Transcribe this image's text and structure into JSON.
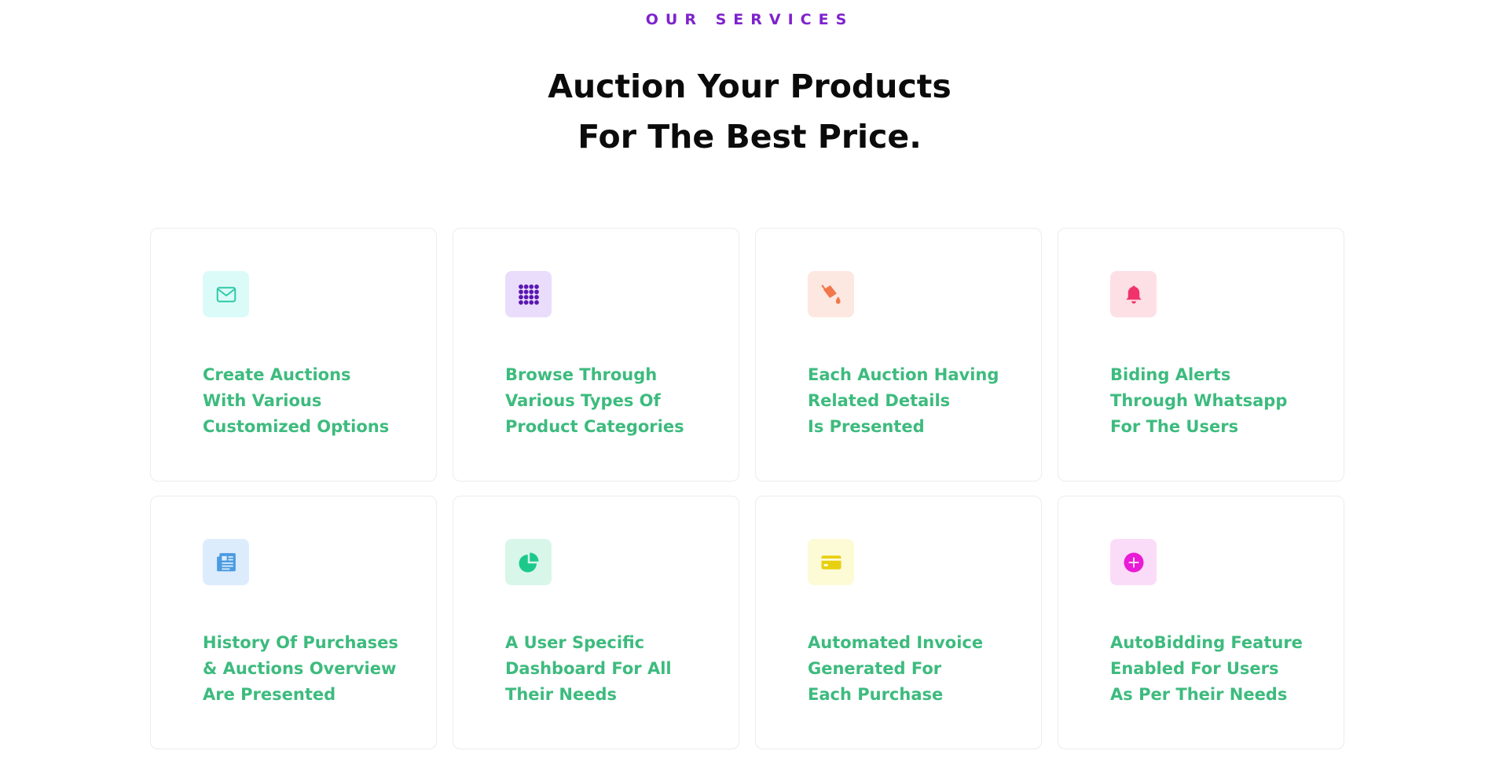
{
  "section": {
    "eyebrow": "OUR SERVICES",
    "title_line1": "Auction Your Products",
    "title_line2": "For The Best Price."
  },
  "colors": {
    "eyebrow": "#7e22ce",
    "title": "#0b0b0b",
    "card_text": "#3dbb7e",
    "card_border": "#ececec"
  },
  "cards": [
    {
      "icon": "envelope-icon",
      "icon_bg": "#dbfbf8",
      "icon_color": "#2ec9a8",
      "lines": [
        "Create Auctions",
        "With Various",
        "Customized Options"
      ]
    },
    {
      "icon": "grid-dots-icon",
      "icon_bg": "#e9ddfb",
      "icon_color": "#5b17b0",
      "lines": [
        "Browse Through",
        "Various Types Of",
        "Product Categories"
      ]
    },
    {
      "icon": "paint-bucket-icon",
      "icon_bg": "#fde8e1",
      "icon_color": "#f2784b",
      "lines": [
        "Each Auction Having",
        "Related Details",
        "Is Presented"
      ]
    },
    {
      "icon": "bell-icon",
      "icon_bg": "#fde0e6",
      "icon_color": "#f0336a",
      "lines": [
        "Biding Alerts",
        "Through Whatsapp",
        "For The Users"
      ]
    },
    {
      "icon": "newspaper-icon",
      "icon_bg": "#dcecfd",
      "icon_color": "#4b9be0",
      "lines": [
        "History Of Purchases",
        "& Auctions Overview",
        "Are Presented"
      ]
    },
    {
      "icon": "pie-chart-icon",
      "icon_bg": "#d9f6ea",
      "icon_color": "#1cc98a",
      "lines": [
        "A User Specific",
        "Dashboard For All",
        "Their Needs"
      ]
    },
    {
      "icon": "credit-card-icon",
      "icon_bg": "#fdfad6",
      "icon_color": "#e8cf10",
      "lines": [
        "Automated Invoice",
        "Generated For",
        "Each Purchase"
      ]
    },
    {
      "icon": "plus-circle-icon",
      "icon_bg": "#fbdcf8",
      "icon_color": "#ea1bd6",
      "lines": [
        "AutoBidding Feature",
        "Enabled For Users",
        "As Per Their Needs"
      ]
    }
  ]
}
